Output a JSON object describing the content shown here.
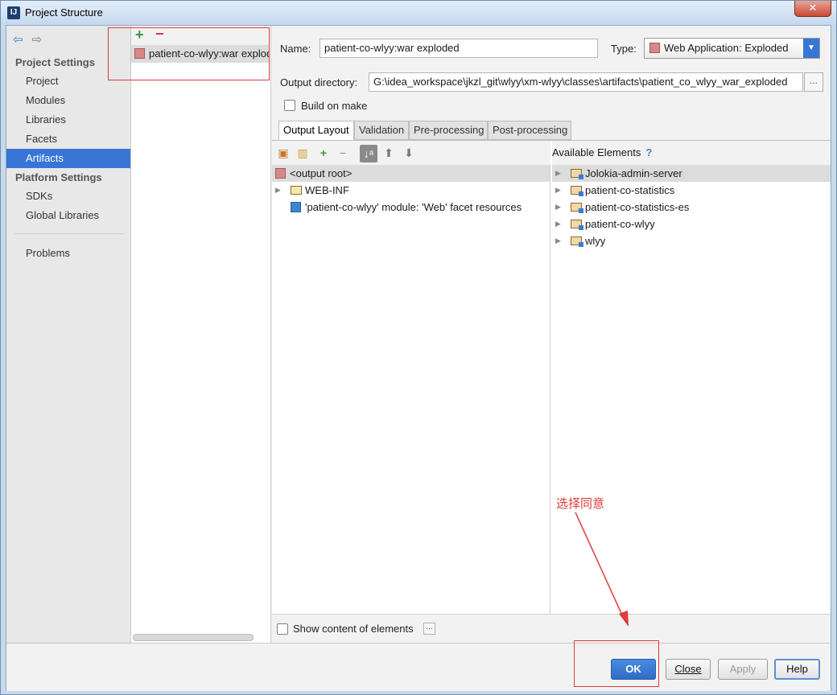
{
  "window": {
    "title": "Project Structure",
    "close_glyph": "✕"
  },
  "nav": {
    "back_glyph": "⇦",
    "forward_glyph": "⇨",
    "project_settings_title": "Project Settings",
    "project_settings_items": [
      "Project",
      "Modules",
      "Libraries",
      "Facets",
      "Artifacts"
    ],
    "platform_settings_title": "Platform Settings",
    "platform_settings_items": [
      "SDKs",
      "Global Libraries"
    ],
    "problems": "Problems",
    "selected": "Artifacts"
  },
  "artifacts": {
    "add_glyph": "+",
    "remove_glyph": "−",
    "items": [
      "patient-co-wlyy:war exploded"
    ]
  },
  "form": {
    "name_label": "Name:",
    "name_value": "patient-co-wlyy:war exploded",
    "type_label": "Type:",
    "type_value": "Web Application: Exploded",
    "output_dir_label": "Output directory:",
    "output_dir_value": "G:\\idea_workspace\\jkzl_git\\wlyy\\xm-wlyy\\classes\\artifacts\\patient_co_wlyy_war_exploded",
    "browse_label": "...",
    "build_on_make_label": "Build on make",
    "build_on_make_checked": false
  },
  "tabs": [
    {
      "label": "Output Layout",
      "active": true
    },
    {
      "label": "Validation",
      "active": false
    },
    {
      "label": "Pre-processing",
      "active": false
    },
    {
      "label": "Post-processing",
      "active": false
    }
  ],
  "layout_tree": [
    {
      "label": "<output root>",
      "icon": "archive-icon",
      "expandable": false,
      "selected": true
    },
    {
      "label": "WEB-INF",
      "icon": "folder-icon",
      "expandable": true,
      "selected": false
    },
    {
      "label": "'patient-co-wlyy' module: 'Web' facet resources",
      "icon": "web-facet-icon",
      "expandable": false,
      "selected": false
    }
  ],
  "available": {
    "title": "Available Elements",
    "help_glyph": "?",
    "items": [
      "Jolokia-admin-server",
      "patient-co-statistics",
      "patient-co-statistics-es",
      "patient-co-wlyy",
      "wlyy"
    ]
  },
  "show_content_label": "Show content of elements",
  "show_content_checked": false,
  "annotation": "选择同意",
  "buttons": {
    "ok": "OK",
    "close": "Close",
    "apply": "Apply",
    "help": "Help"
  },
  "colors": {
    "accent": "#3875d7",
    "annotation_red": "#e03a3a"
  }
}
